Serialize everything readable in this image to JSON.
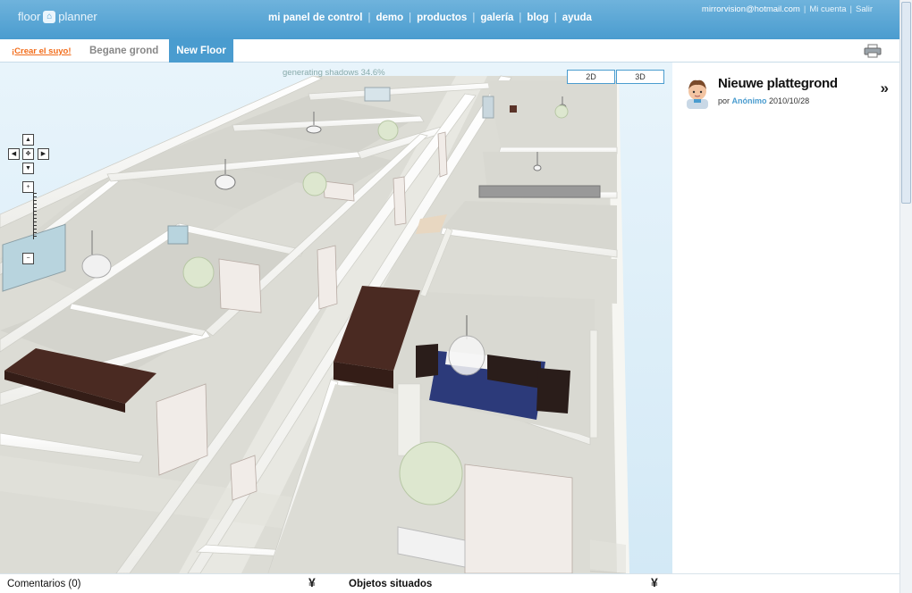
{
  "header": {
    "logo_text_1": "floor",
    "logo_text_2": "planner",
    "nav": [
      "mi panel de control",
      "demo",
      "productos",
      "galería",
      "blog",
      "ayuda"
    ],
    "user_email": "mirrorvision@hotmail.com",
    "account_link": "Mi cuenta",
    "logout_link": "Salir"
  },
  "tabs": {
    "create_link": "¡Crear el suyo!",
    "floors": [
      "Begane grond",
      "New Floor"
    ],
    "active_floor": "New Floor"
  },
  "viewport": {
    "status_text": "generating shadows 34.6%",
    "view_2d_label": "2D",
    "view_3d_label": "3D",
    "active_view": "3D"
  },
  "info": {
    "title": "Nieuwe plattegrond",
    "by_prefix": "por",
    "author": "Anónimo",
    "date": "2010/10/28",
    "expand_glyph": "»"
  },
  "bottom": {
    "comments_label": "Comentarios (0)",
    "objects_label": "Objetos situados",
    "collapse_glyph": "¥"
  },
  "colors": {
    "header_bg": "#4a9ccf",
    "accent_link": "#f26c1a",
    "wall": "#f4f4f0",
    "floor": "#dcdcd6",
    "furniture_dark": "#4a2a22",
    "bed_blue": "#2c3a7a"
  }
}
